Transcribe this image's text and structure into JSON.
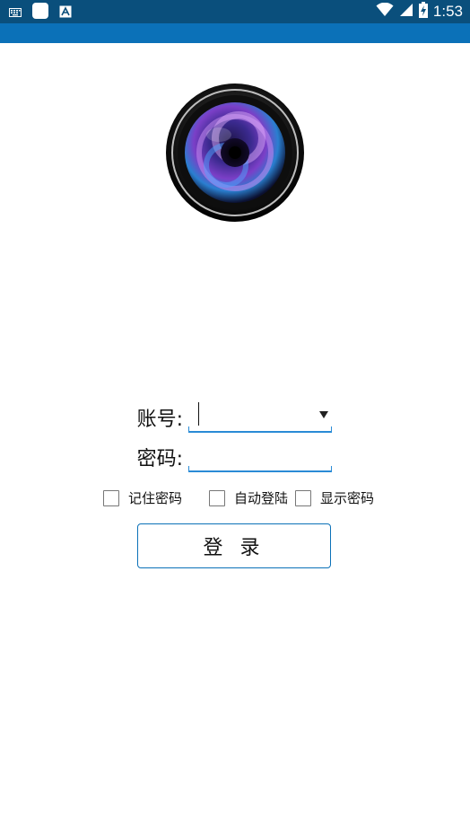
{
  "status_bar": {
    "time": "1:53",
    "left_icons": [
      "keyboard-icon",
      "app-square-icon",
      "font-a-icon"
    ],
    "right_icons": [
      "wifi-icon",
      "signal-icon",
      "battery-charging-icon"
    ]
  },
  "colors": {
    "status_bar_bg": "#0a4f7c",
    "app_bar_bg": "#0b71b8",
    "accent": "#2a8bd6"
  },
  "logo": {
    "icon": "camera-lens-icon"
  },
  "form": {
    "account_label": "账号:",
    "account_value": "",
    "password_label": "密码:",
    "password_value": ""
  },
  "options": {
    "remember_password": "记住密码",
    "auto_login": "自动登陆",
    "show_password": "显示密码"
  },
  "login_button_label": "登 录"
}
